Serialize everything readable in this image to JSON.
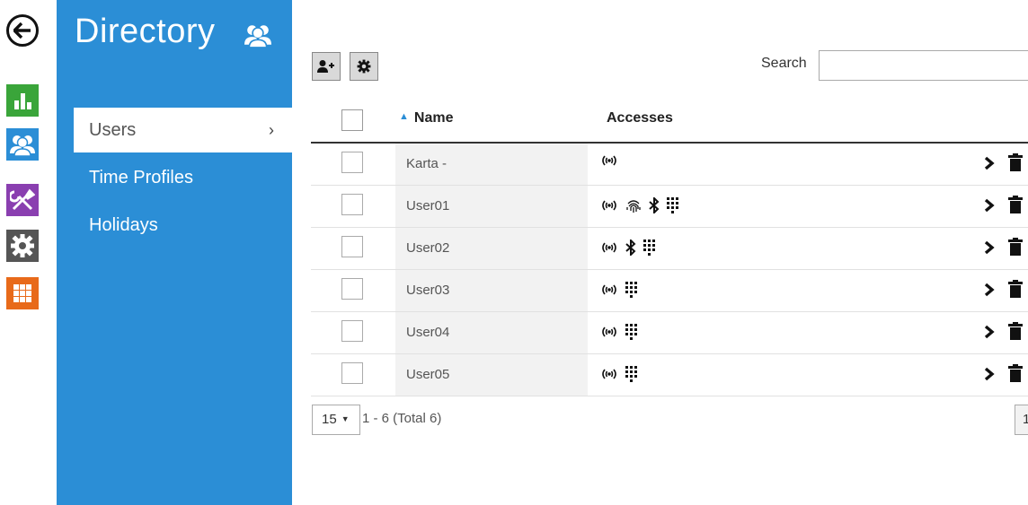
{
  "rail": {
    "tiles": [
      {
        "name": "status",
        "color": "#3aa53a",
        "icon": "bar-chart-icon"
      },
      {
        "name": "directory",
        "color": "#2b8ed6",
        "icon": "users-icon"
      },
      {
        "name": "services",
        "color": "#8a3fb0",
        "icon": "tools-icon"
      },
      {
        "name": "system",
        "color": "#555555",
        "icon": "gear-icon"
      },
      {
        "name": "hardware",
        "color": "#e86a1a",
        "icon": "grid-icon"
      }
    ]
  },
  "sidebar": {
    "title": "Directory",
    "items": [
      {
        "label": "Users",
        "active": true,
        "chevron": "›"
      },
      {
        "label": "Time Profiles",
        "active": false
      },
      {
        "label": "Holidays",
        "active": false
      }
    ]
  },
  "toolbar": {
    "search_label": "Search",
    "search_value": ""
  },
  "table": {
    "headers": {
      "name": "Name",
      "accesses": "Accesses"
    },
    "rows": [
      {
        "name": "Karta -",
        "accesses": [
          "rfid"
        ]
      },
      {
        "name": "User01",
        "accesses": [
          "rfid",
          "fingerprint",
          "bluetooth",
          "keypad"
        ]
      },
      {
        "name": "User02",
        "accesses": [
          "rfid",
          "bluetooth",
          "keypad"
        ]
      },
      {
        "name": "User03",
        "accesses": [
          "rfid",
          "keypad"
        ]
      },
      {
        "name": "User04",
        "accesses": [
          "rfid",
          "keypad"
        ]
      },
      {
        "name": "User05",
        "accesses": [
          "rfid",
          "keypad"
        ]
      }
    ]
  },
  "footer": {
    "page_size": "15",
    "range_text": "1 - 6 (Total 6)",
    "page": "1"
  },
  "colors": {
    "accent": "#2b8ed6"
  }
}
